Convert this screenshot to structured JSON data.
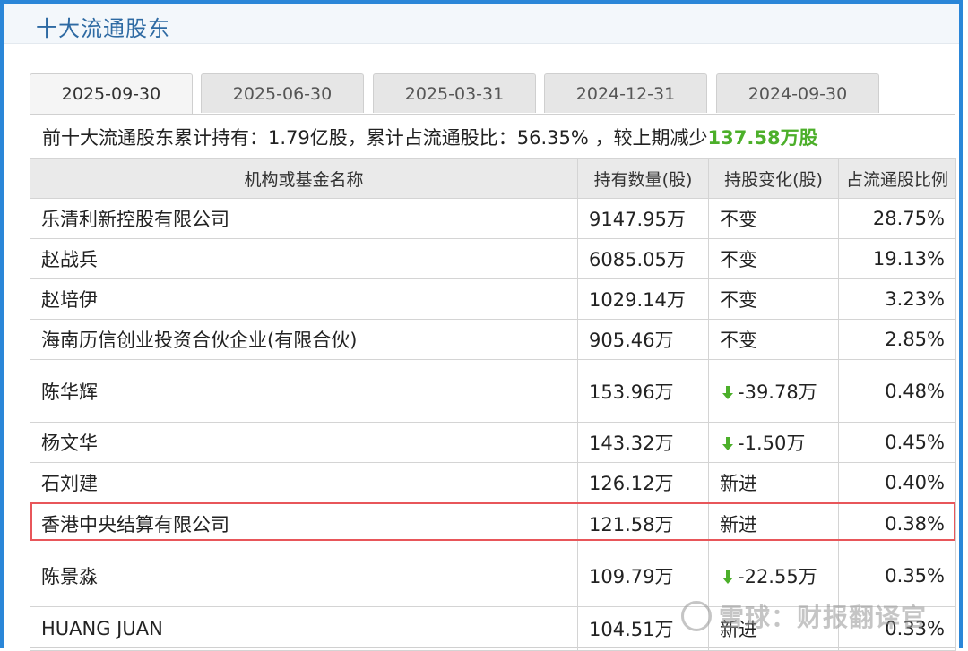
{
  "header": {
    "title": "十大流通股东"
  },
  "tabs": [
    {
      "label": "2025-09-30",
      "active": true
    },
    {
      "label": "2025-06-30",
      "active": false
    },
    {
      "label": "2025-03-31",
      "active": false
    },
    {
      "label": "2024-12-31",
      "active": false
    },
    {
      "label": "2024-09-30",
      "active": false
    }
  ],
  "summary": {
    "prefix": "前十大流通股东累计持有：",
    "total_holding": "1.79亿股",
    "mid": "，累计占流通股比：",
    "total_ratio": "56.35%",
    "suffix": " ，较上期减少",
    "decrease": "137.58万股"
  },
  "table": {
    "columns": [
      "机构或基金名称",
      "持有数量(股)",
      "持股变化(股)",
      "占流通股比例"
    ],
    "rows": [
      {
        "name": "乐清利新控股有限公司",
        "amount": "9147.95万",
        "change": "不变",
        "change_type": "same",
        "ratio": "28.75%"
      },
      {
        "name": "赵战兵",
        "amount": "6085.05万",
        "change": "不变",
        "change_type": "same",
        "ratio": "19.13%"
      },
      {
        "name": "赵培伊",
        "amount": "1029.14万",
        "change": "不变",
        "change_type": "same",
        "ratio": "3.23%"
      },
      {
        "name": "海南历信创业投资合伙企业(有限合伙)",
        "amount": "905.46万",
        "change": "不变",
        "change_type": "same",
        "ratio": "2.85%"
      },
      {
        "name": "陈华辉",
        "amount": "153.96万",
        "change": "-39.78万",
        "change_type": "down",
        "ratio": "0.48%"
      },
      {
        "name": "杨文华",
        "amount": "143.32万",
        "change": "-1.50万",
        "change_type": "down",
        "ratio": "0.45%"
      },
      {
        "name": "石刘建",
        "amount": "126.12万",
        "change": "新进",
        "change_type": "new",
        "ratio": "0.40%"
      },
      {
        "name": "香港中央结算有限公司",
        "amount": "121.58万",
        "change": "新进",
        "change_type": "new",
        "ratio": "0.38%",
        "highlighted": true
      },
      {
        "name": "陈景淼",
        "amount": "109.79万",
        "change": "-22.55万",
        "change_type": "down",
        "ratio": "0.35%"
      },
      {
        "name": "HUANG JUAN",
        "amount": "104.51万",
        "change": "新进",
        "change_type": "new",
        "ratio": "0.33%"
      }
    ]
  },
  "colors": {
    "accent_blue": "#2a86d8",
    "increase_green": "#4caf2a",
    "new_red": "#d3281f",
    "highlight_border": "#e8565a"
  },
  "watermark": {
    "text": "雪球：财报翻译官"
  }
}
